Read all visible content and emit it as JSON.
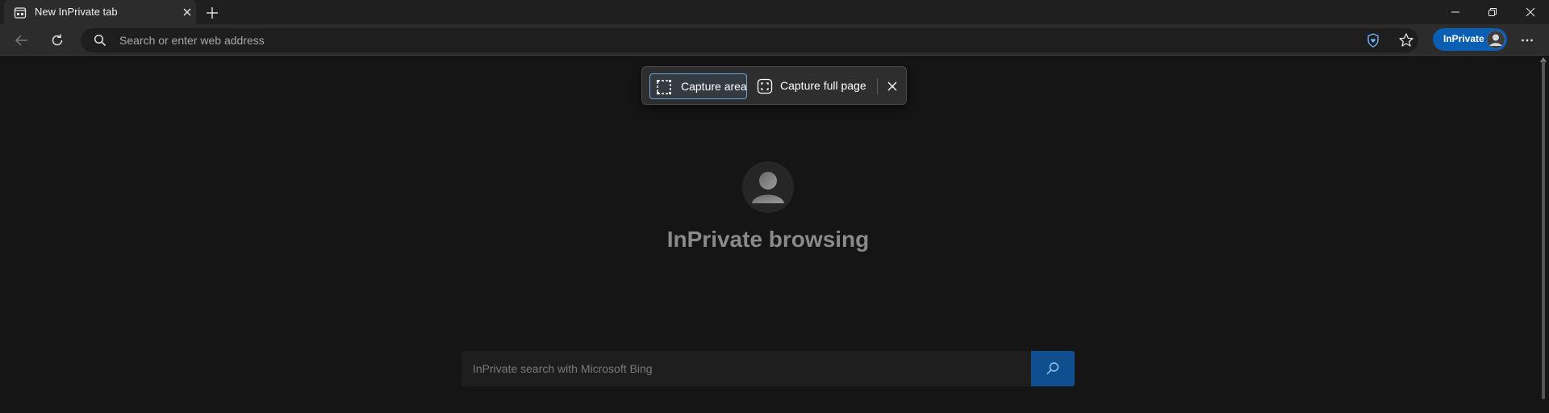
{
  "tab": {
    "title": "New InPrivate tab",
    "favicon": "inprivate-tab-icon"
  },
  "window_controls": {
    "icons": [
      "minimize-icon",
      "restore-icon",
      "close-icon"
    ]
  },
  "toolbar": {
    "address_placeholder": "Search or enter web address",
    "inprivate_label": "InPrivate",
    "accent_color": "#0a5fb4"
  },
  "capture": {
    "area_label": "Capture area",
    "full_page_label": "Capture full page"
  },
  "main": {
    "heading": "InPrivate browsing"
  },
  "search": {
    "placeholder": "InPrivate search with Microsoft Bing",
    "button_color": "#0f4f8f"
  }
}
